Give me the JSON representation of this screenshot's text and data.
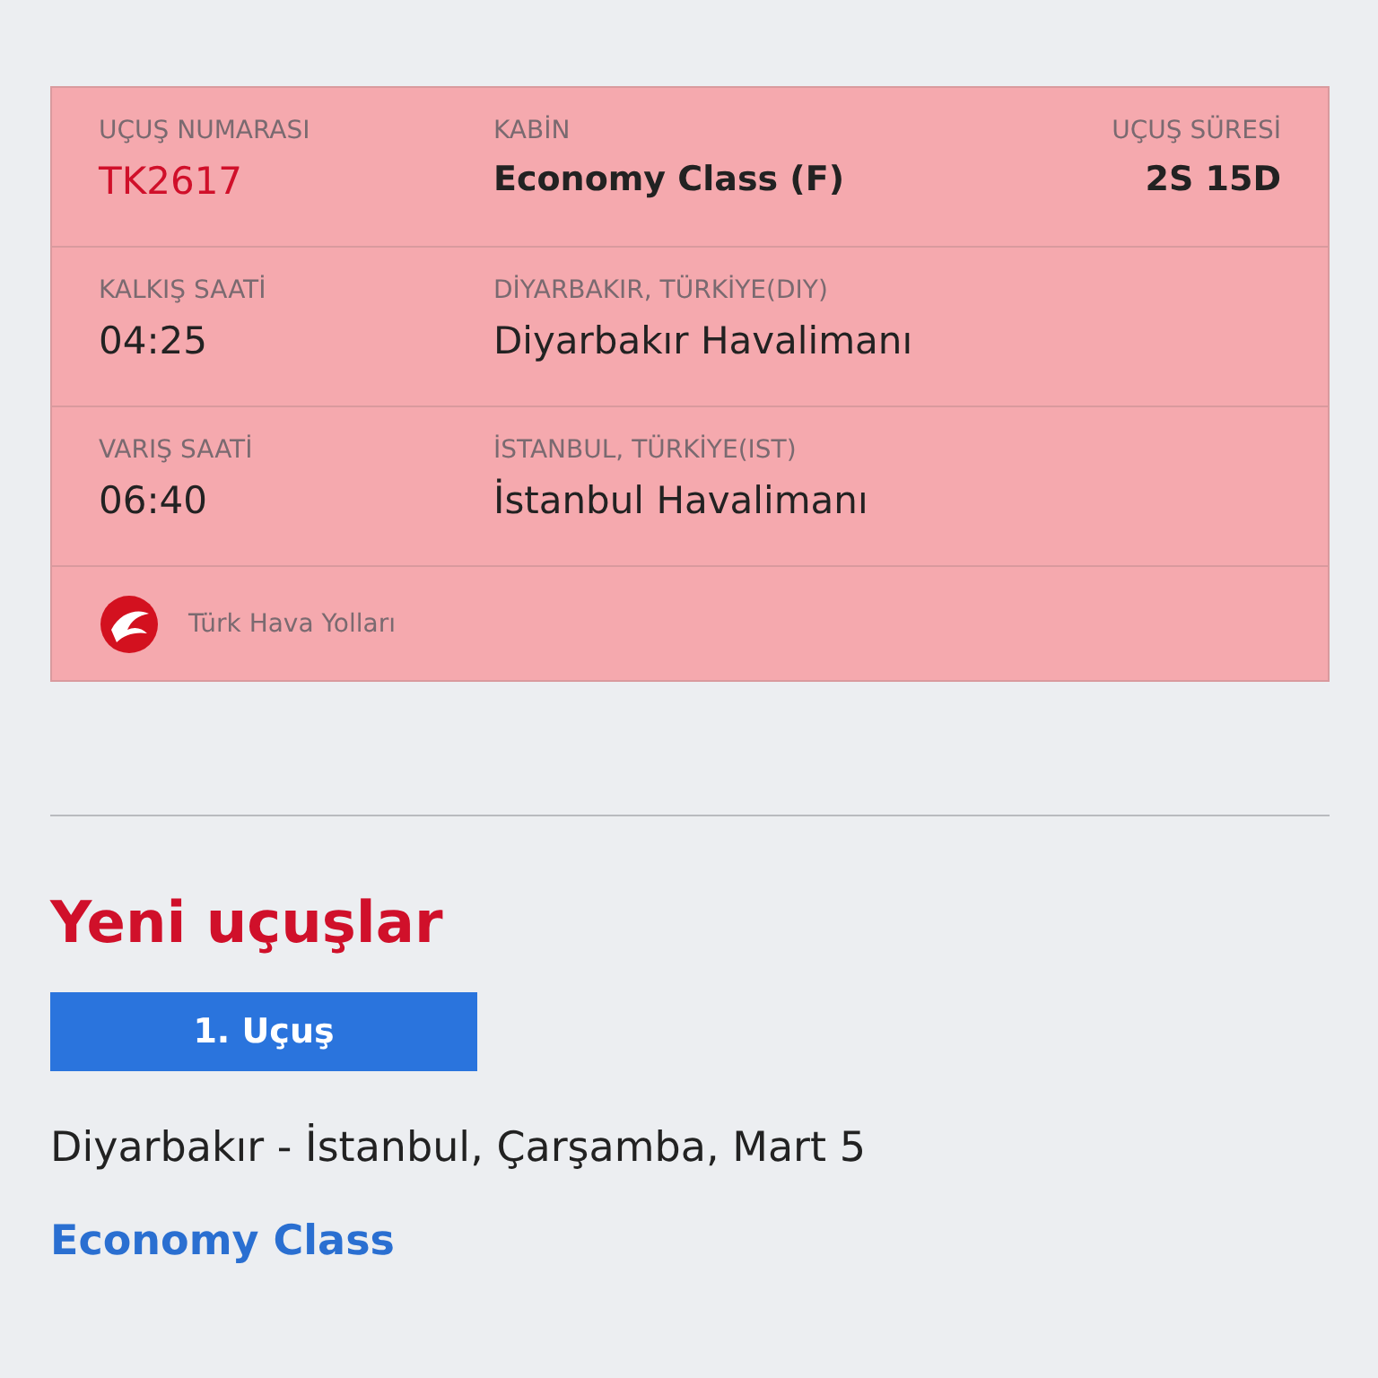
{
  "flight_card": {
    "number_label": "UÇUŞ NUMARASI",
    "number": "TK2617",
    "cabin_label": "KABİN",
    "cabin": "Economy Class (F)",
    "duration_label": "UÇUŞ SÜRESİ",
    "duration": "2S 15D",
    "segments": [
      {
        "time_label": "KALKIŞ SAATİ",
        "time": "04:25",
        "city": "DİYARBAKIR, TÜRKİYE(DIY)",
        "airport": "Diyarbakır Havalimanı"
      },
      {
        "time_label": "VARIŞ SAATİ",
        "time": "06:40",
        "city": "İSTANBUL, TÜRKİYE(IST)",
        "airport": "İstanbul Havalimanı"
      }
    ],
    "airline": "Türk Hava Yolları"
  },
  "new_flights": {
    "title": "Yeni uçuşlar",
    "tabs": [
      {
        "label": "1. Uçuş",
        "selected": true
      }
    ],
    "route": "Diyarbakır - İstanbul, Çarşamba, Mart 5",
    "cabin": "Economy Class"
  }
}
